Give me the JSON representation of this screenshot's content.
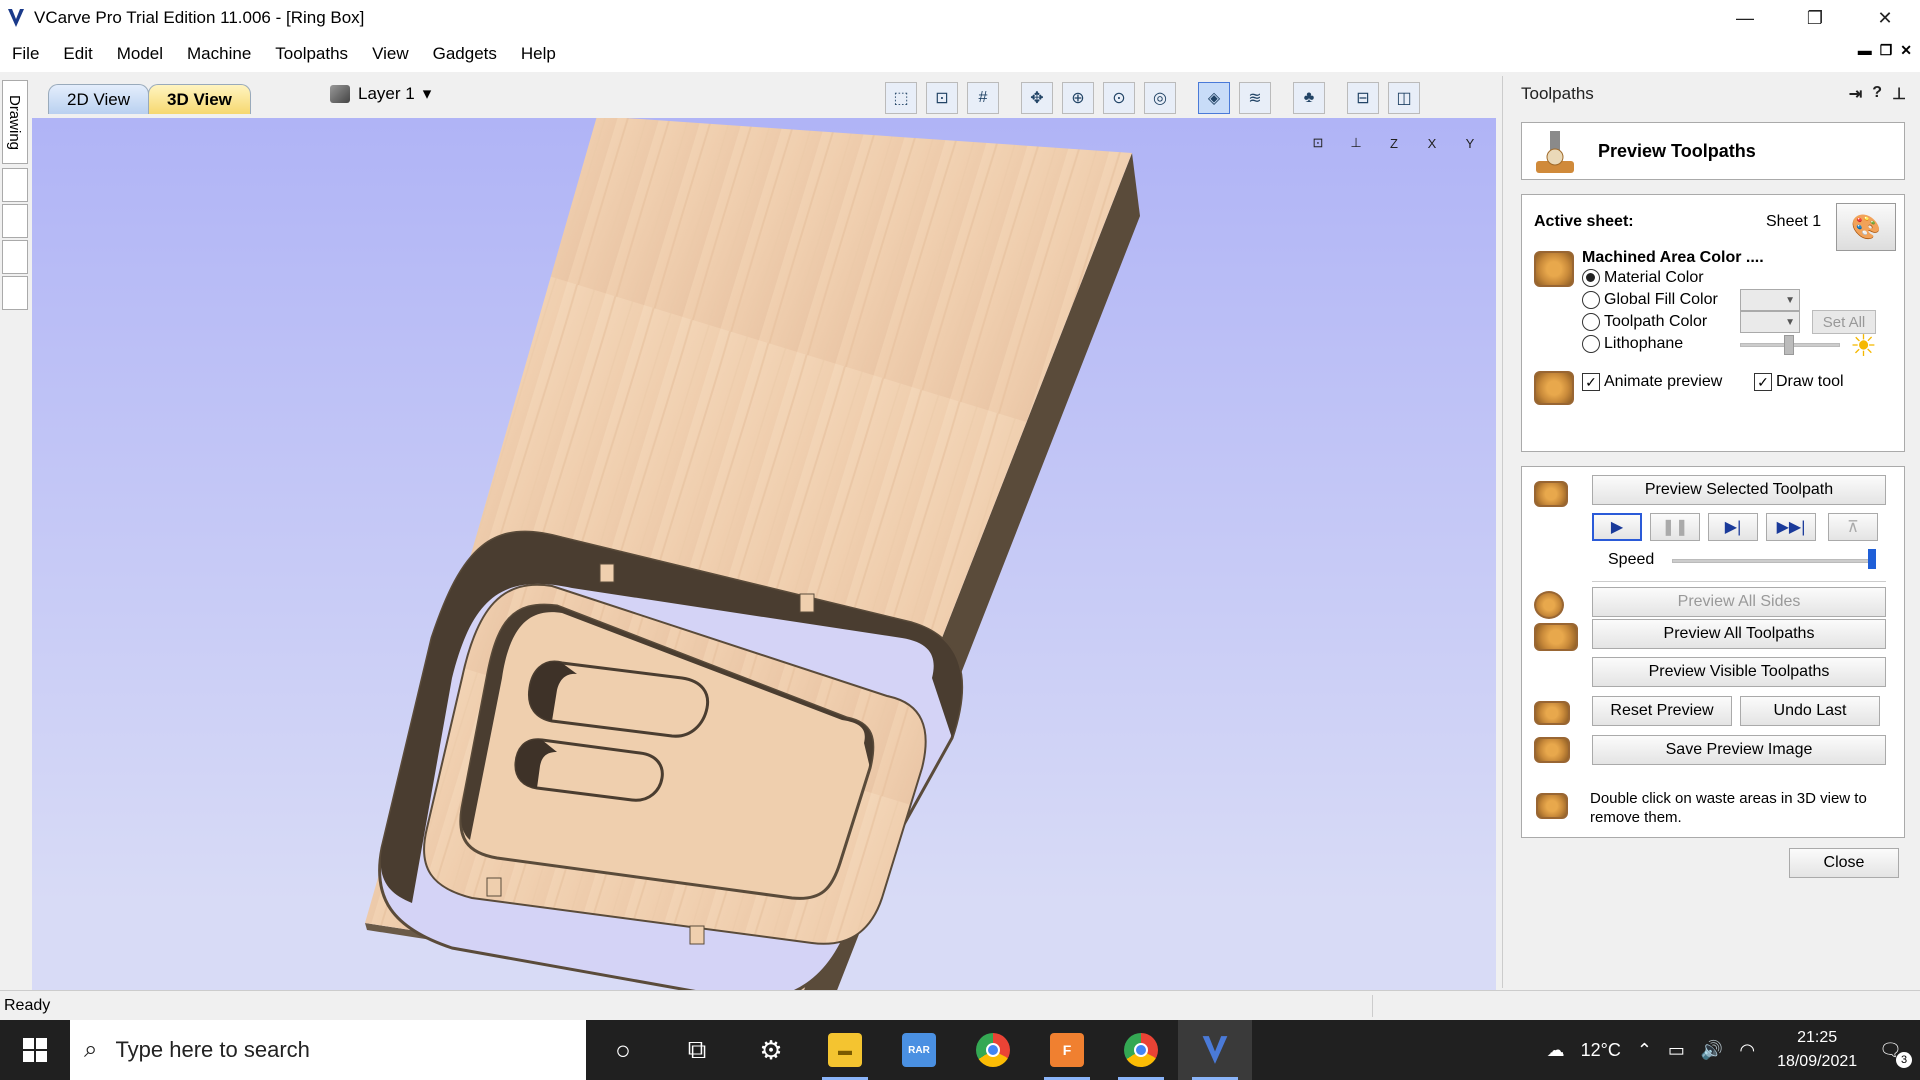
{
  "window": {
    "title": "VCarve Pro Trial Edition 11.006 - [Ring Box]",
    "controls": [
      "minimize",
      "restore",
      "close"
    ]
  },
  "menu": {
    "items": [
      "File",
      "Edit",
      "Model",
      "Machine",
      "Toolpaths",
      "View",
      "Gadgets",
      "Help"
    ]
  },
  "left_strip": {
    "drawing_tab": "Drawing"
  },
  "toolbar": {
    "tab_2d": "2D View",
    "tab_3d": "3D View",
    "layer": "Layer 1",
    "layer_caret": "▾"
  },
  "viewport": {
    "axis_buttons": [
      "fit-view",
      "iso-view",
      "z-view",
      "x-view",
      "y-view"
    ]
  },
  "panel": {
    "header": "Toolpaths",
    "title": "Preview Toolpaths",
    "active_sheet_label": "Active sheet:",
    "active_sheet_value": "Sheet 1",
    "machined_area_label": "Machined Area Color ....",
    "radio_material": "Material Color",
    "radio_global": "Global Fill Color",
    "radio_toolpath": "Toolpath Color",
    "radio_lithophane": "Lithophane",
    "set_all": "Set All",
    "animate_preview": "Animate preview",
    "draw_tool": "Draw tool",
    "preview_selected": "Preview Selected Toolpath",
    "speed_label": "Speed",
    "speed_value": 1.0,
    "preview_all_sides": "Preview All Sides",
    "preview_all_toolpaths": "Preview All Toolpaths",
    "preview_visible": "Preview Visible Toolpaths",
    "reset_preview": "Reset Preview",
    "undo_last": "Undo Last",
    "save_preview_image": "Save Preview Image",
    "hint": "Double click on waste areas in 3D view to remove them.",
    "close": "Close"
  },
  "status": {
    "text": "Ready"
  },
  "taskbar": {
    "search_placeholder": "Type here to search",
    "weather": "12°C",
    "time": "21:25",
    "date": "18/09/2021",
    "notifications": "3"
  }
}
